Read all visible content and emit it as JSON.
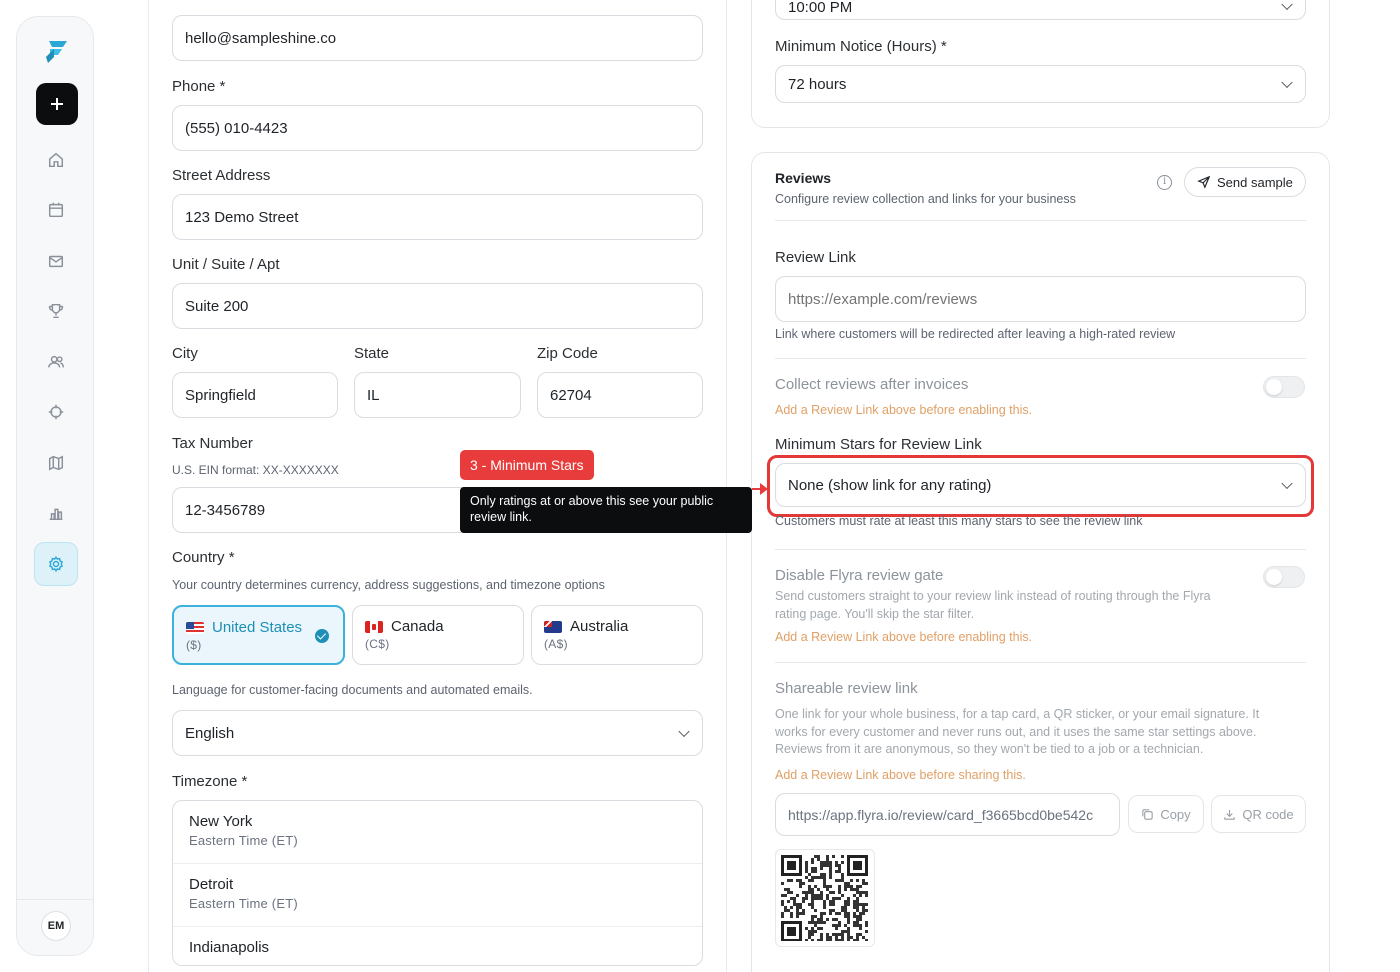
{
  "sidebar": {
    "avatar_initials": "EM",
    "nav": [
      "home-icon",
      "calendar-icon",
      "mail-icon",
      "trophy-icon",
      "users-icon",
      "crosshair-icon",
      "map-icon",
      "chart-icon",
      "settings-icon"
    ],
    "active": "settings-icon",
    "accent": "#2ba7d6"
  },
  "business": {
    "email_value": "hello@sampleshine.co",
    "phone_label": "Phone *",
    "phone_value": "(555) 010-4423",
    "street_label": "Street Address",
    "street_value": "123 Demo Street",
    "unit_label": "Unit / Suite / Apt",
    "unit_value": "Suite 200",
    "city_label": "City",
    "city_value": "Springfield",
    "state_label": "State",
    "state_value": "IL",
    "zip_label": "Zip Code",
    "zip_value": "62704",
    "tax_label": "Tax Number",
    "tax_hint": "U.S. EIN format: XX-XXXXXXX",
    "tax_value": "12-3456789",
    "country_label": "Country *",
    "country_hint": "Your country determines currency, address suggestions, and timezone options",
    "countries": [
      {
        "name": "United States",
        "currency": "($)",
        "flag": "us-flag-icon",
        "selected": true
      },
      {
        "name": "Canada",
        "currency": "(C$)",
        "flag": "canada-flag-icon",
        "selected": false
      },
      {
        "name": "Australia",
        "currency": "(A$)",
        "flag": "australia-flag-icon",
        "selected": false
      }
    ],
    "language_hint": "Language for customer-facing documents and automated emails.",
    "language_value": "English",
    "timezone_label": "Timezone *",
    "timezones": [
      {
        "city": "New York",
        "zone": "Eastern Time (ET)"
      },
      {
        "city": "Detroit",
        "zone": "Eastern Time (ET)"
      },
      {
        "city": "Indianapolis",
        "zone": ""
      }
    ]
  },
  "tooltip": {
    "badge": "3 - Minimum Stars",
    "text": "Only ratings at or above this see your public review link.",
    "badge_color": "#e83b3b"
  },
  "scheduling": {
    "time_value": "10:00 PM",
    "notice_label": "Minimum Notice (Hours) *",
    "notice_value": "72 hours"
  },
  "reviews": {
    "title": "Reviews",
    "subtitle": "Configure review collection and links for your business",
    "send_sample": "Send sample",
    "review_link_label": "Review Link",
    "review_link_placeholder": "https://example.com/reviews",
    "review_link_hint": "Link where customers will be redirected after leaving a high-rated review",
    "collect_label": "Collect reviews after invoices",
    "collect_warning": "Add a Review Link above before enabling this.",
    "min_stars_label": "Minimum Stars for Review Link",
    "min_stars_value": "None (show link for any rating)",
    "min_stars_hint": "Customers must rate at least this many stars to see the review link",
    "disable_gate_label": "Disable Flyra review gate",
    "disable_gate_desc": "Send customers straight to your review link instead of routing through the Flyra rating page. You'll skip the star filter.",
    "disable_gate_warning": "Add a Review Link above before enabling this.",
    "shareable_label": "Shareable review link",
    "shareable_desc": "One link for your whole business, for a tap card, a QR sticker, or your email signature. It works for every customer and never runs out, and it uses the same star settings above. Reviews from it are anonymous, so they won't be tied to a job or a technician.",
    "shareable_warning": "Add a Review Link above before sharing this.",
    "shareable_url": "https://app.flyra.io/review/card_f3665bcd0be542c",
    "copy_label": "Copy",
    "qr_label": "QR code"
  }
}
